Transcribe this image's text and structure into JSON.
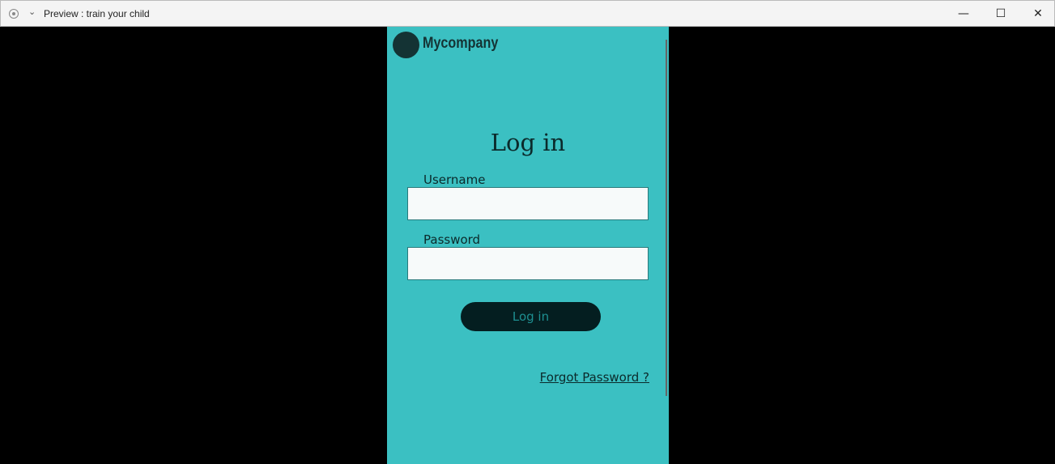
{
  "window": {
    "title": "Preview : train your child",
    "minimize": "—",
    "maximize": "☐",
    "close": "✕",
    "menu": "⌄"
  },
  "app": {
    "brand": "Mycompany",
    "heading": "Log in",
    "username_label": "Username",
    "username_value": "",
    "password_label": "Password",
    "password_value": "",
    "login_button": "Log in",
    "forgot_link": "Forgot Password ?",
    "colors": {
      "background": "#3bc0c2",
      "button": "#041e20",
      "text": "#0b2a2b"
    }
  }
}
